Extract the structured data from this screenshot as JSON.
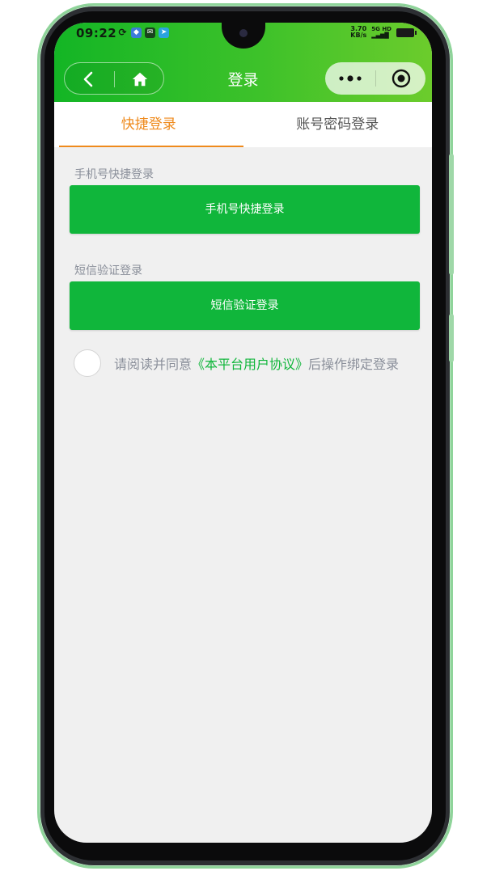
{
  "status_bar": {
    "time": "09:22",
    "net_speed_value": "3.70",
    "net_speed_unit": "KB/s",
    "network": "5G HD",
    "icons": [
      "sync-icon",
      "app-icon",
      "mail-icon",
      "telegram-icon"
    ]
  },
  "nav": {
    "title": "登录",
    "back_icon": "chevron-left-icon",
    "home_icon": "home-icon",
    "more_icon": "more-dots-icon",
    "close_icon": "target-circle-icon"
  },
  "tabs": [
    {
      "label": "快捷登录",
      "active": true
    },
    {
      "label": "账号密码登录",
      "active": false
    }
  ],
  "sections": {
    "phone": {
      "label": "手机号快捷登录",
      "button": "手机号快捷登录"
    },
    "sms": {
      "label": "短信验证登录",
      "button": "短信验证登录"
    }
  },
  "agreement": {
    "prefix": "请阅读并同意",
    "link": "《本平台用户协议》",
    "suffix": "后操作绑定登录"
  },
  "colors": {
    "accent_green": "#10b63b",
    "tab_active": "#ef8a1c",
    "background": "#f0f0f0"
  }
}
